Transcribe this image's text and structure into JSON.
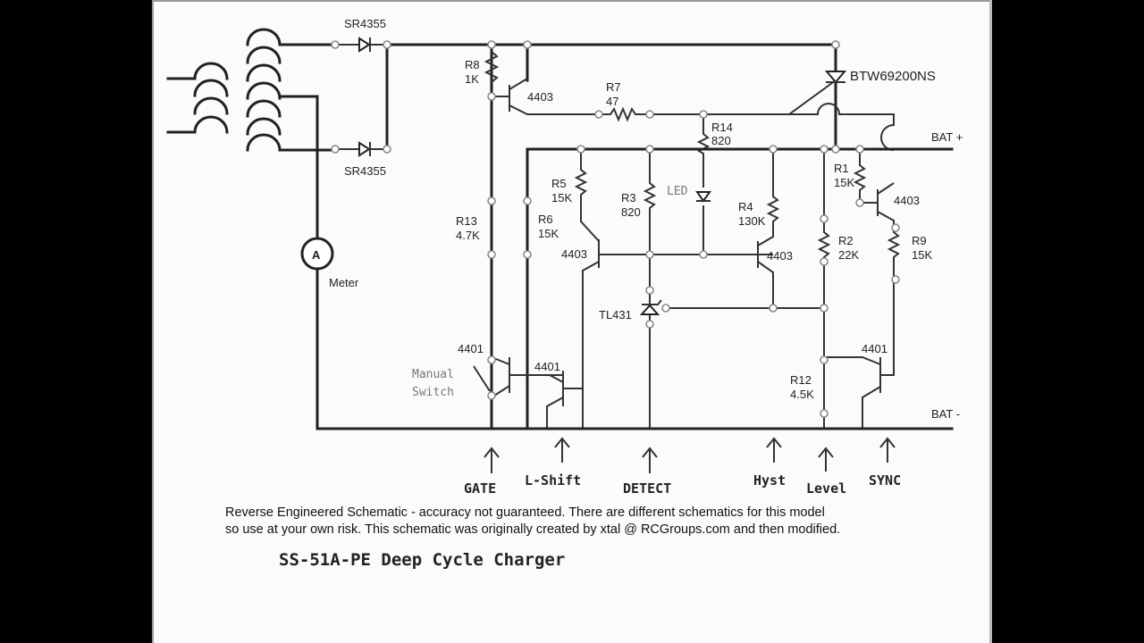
{
  "diagram": {
    "title": "SS-51A-PE Deep Cycle Charger",
    "disclaimer_line1": "Reverse Engineered Schematic - accuracy not guaranteed.  There are different schematics for this model",
    "disclaimer_line2": "so use at your own risk.  This schematic was originally created by xtal @ RCGroups.com and then modified.",
    "components": {
      "d_top": "SR4355",
      "d_bot": "SR4355",
      "scr": "BTW69200NS",
      "r8_name": "R8",
      "r8_val": "1K",
      "q_top": "4403",
      "r7_name": "R7",
      "r7_val": "47",
      "r14_name": "R14",
      "r14_val": "820",
      "r5_name": "R5",
      "r5_val": "15K",
      "r3_name": "R3",
      "r3_val": "820",
      "led": "LED",
      "r4_name": "R4",
      "r4_val": "130K",
      "r1_name": "R1",
      "r1_val": "15K",
      "q_r1": "4403",
      "r13_name": "R13",
      "r13_val": "4.7K",
      "r6_name": "R6",
      "r6_val": "15K",
      "q_mid_left": "4403",
      "q_mid_right": "4403",
      "r2_name": "R2",
      "r2_val": "22K",
      "r9_name": "R9",
      "r9_val": "15K",
      "tl431": "TL431",
      "meter_symbol": "A",
      "meter": "Meter",
      "q_gate": "4401",
      "manual_switch_1": "Manual",
      "manual_switch_2": "Switch",
      "q_lshift": "4401",
      "r12_name": "R12",
      "r12_val": "4.5K",
      "q_sync": "4401",
      "bat_plus": "BAT +",
      "bat_minus": "BAT -"
    },
    "test_points": [
      "GATE",
      "L-Shift",
      "DETECT",
      "Hyst",
      "Level",
      "SYNC"
    ]
  }
}
